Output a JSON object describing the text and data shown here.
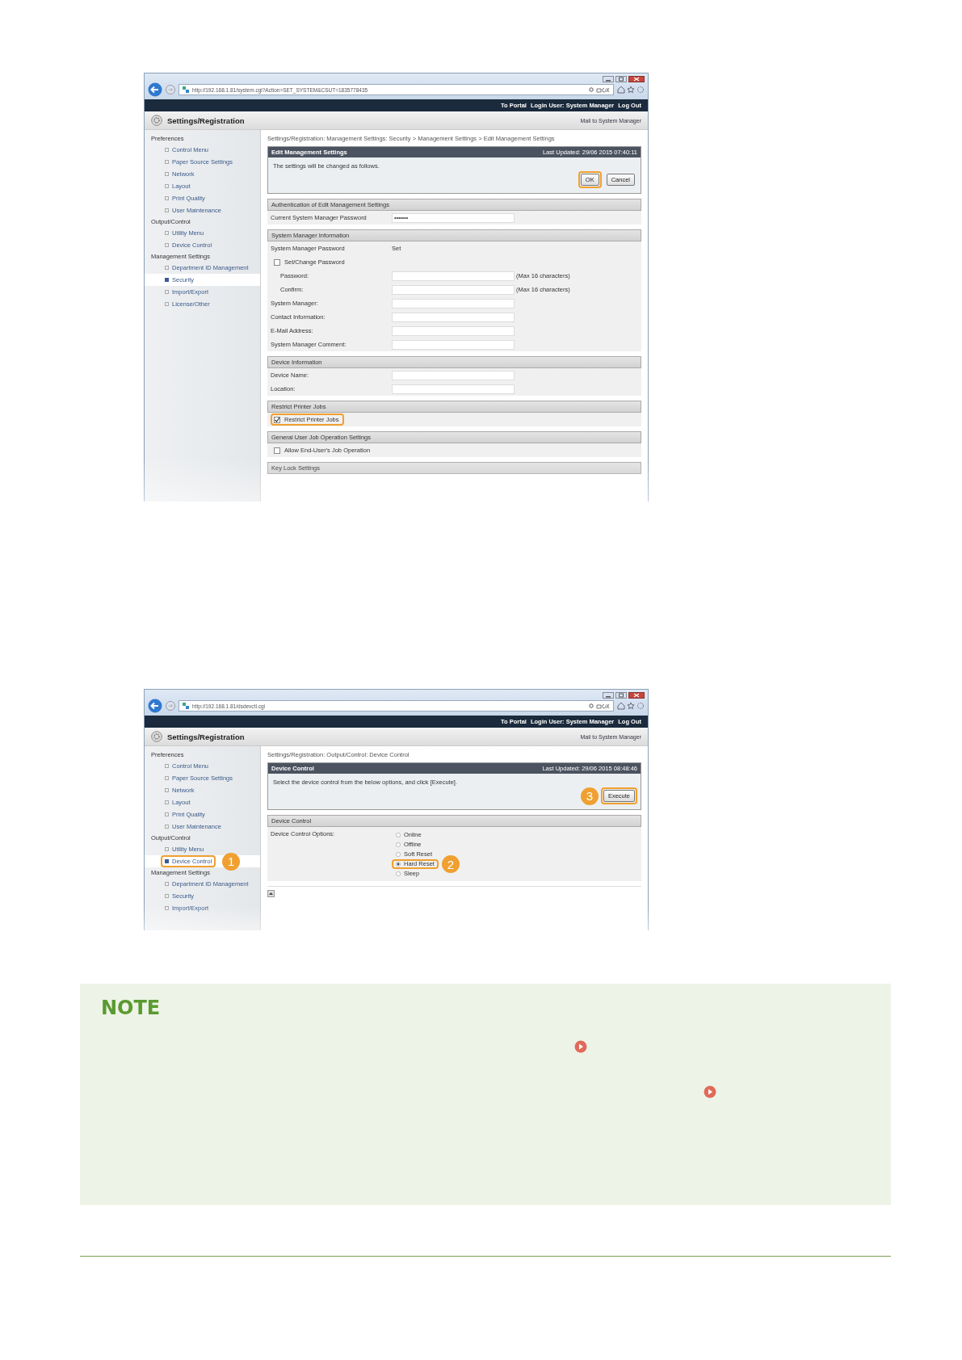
{
  "screenshots": [
    {
      "address": "http://192.168.1.81/system.cgi?Action=SET_SYSTEM&CSUT=1835778435",
      "header_links": [
        "To Portal",
        "Login User: System Manager",
        "Log Out"
      ],
      "app_title": "Settings/Registration",
      "mail_link": "Mail to System Manager",
      "sidebar": [
        {
          "heading": "Preferences",
          "items": [
            {
              "label": "Control Menu",
              "selected": false,
              "highlighted": false
            },
            {
              "label": "Paper Source Settings",
              "selected": false,
              "highlighted": false
            },
            {
              "label": "Network",
              "selected": false,
              "highlighted": false
            },
            {
              "label": "Layout",
              "selected": false,
              "highlighted": false
            },
            {
              "label": "Print Quality",
              "selected": false,
              "highlighted": false
            },
            {
              "label": "User Maintenance",
              "selected": false,
              "highlighted": false
            }
          ]
        },
        {
          "heading": "Output/Control",
          "items": [
            {
              "label": "Utility Menu",
              "selected": false,
              "highlighted": false
            },
            {
              "label": "Device Control",
              "selected": false,
              "highlighted": false
            }
          ]
        },
        {
          "heading": "Management Settings",
          "items": [
            {
              "label": "Department ID Management",
              "selected": false,
              "highlighted": false
            },
            {
              "label": "Security",
              "selected": true,
              "highlighted": false
            },
            {
              "label": "Import/Export",
              "selected": false,
              "highlighted": false
            },
            {
              "label": "License/Other",
              "selected": false,
              "highlighted": false
            }
          ]
        }
      ],
      "breadcrumb": "Settings/Registration: Management Settings: Security > Management Settings > Edit Management Settings",
      "panel": {
        "title": "Edit Management Settings",
        "last_updated": "Last Updated: 29/06 2015 07:40:11",
        "message": "The settings will be changed as follows.",
        "buttons": [
          {
            "label": "OK",
            "highlighted": true
          },
          {
            "label": "Cancel",
            "highlighted": false
          }
        ]
      },
      "sections": [
        {
          "title": "Authentication of Edit Management Settings",
          "rows": [
            {
              "kind": "field",
              "label": "Current System Manager Password",
              "value": "•••••••"
            }
          ]
        },
        {
          "title": "System Manager Information",
          "rows": [
            {
              "kind": "value",
              "label": "System Manager Password",
              "value": "Set"
            },
            {
              "kind": "check",
              "label": "Set/Change Password",
              "checked": false,
              "highlighted": false
            },
            {
              "kind": "field",
              "label": "Password:",
              "note": "(Max 16 characters)",
              "indent": true
            },
            {
              "kind": "field",
              "label": "Confirm:",
              "note": "(Max 16 characters)",
              "indent": true
            },
            {
              "kind": "field",
              "label": "System Manager:"
            },
            {
              "kind": "field",
              "label": "Contact Information:"
            },
            {
              "kind": "field",
              "label": "E-Mail Address:"
            },
            {
              "kind": "field",
              "label": "System Manager Comment:"
            }
          ]
        },
        {
          "title": "Device Information",
          "rows": [
            {
              "kind": "field",
              "label": "Device Name:"
            },
            {
              "kind": "field",
              "label": "Location:"
            }
          ]
        },
        {
          "title": "Restrict Printer Jobs",
          "rows": [
            {
              "kind": "check",
              "label": "Restrict Printer Jobs",
              "checked": true,
              "highlighted": true
            }
          ]
        },
        {
          "title": "General User Job Operation Settings",
          "rows": [
            {
              "kind": "check",
              "label": "Allow End-User's Job Operation",
              "checked": false,
              "highlighted": false
            }
          ]
        },
        {
          "title": "Key Lock Settings"
        }
      ]
    },
    {
      "address": "http://192.168.1.81/dsdevctl.cgi",
      "header_links": [
        "To Portal",
        "Login User: System Manager",
        "Log Out"
      ],
      "app_title": "Settings/Registration",
      "mail_link": "Mail to System Manager",
      "sidebar": [
        {
          "heading": "Preferences",
          "items": [
            {
              "label": "Control Menu",
              "selected": false,
              "highlighted": false
            },
            {
              "label": "Paper Source Settings",
              "selected": false,
              "highlighted": false
            },
            {
              "label": "Network",
              "selected": false,
              "highlighted": false
            },
            {
              "label": "Layout",
              "selected": false,
              "highlighted": false
            },
            {
              "label": "Print Quality",
              "selected": false,
              "highlighted": false
            },
            {
              "label": "User Maintenance",
              "selected": false,
              "highlighted": false
            }
          ]
        },
        {
          "heading": "Output/Control",
          "items": [
            {
              "label": "Utility Menu",
              "selected": false,
              "highlighted": false
            },
            {
              "label": "Device Control",
              "selected": true,
              "highlighted": true,
              "callout": "1"
            }
          ]
        },
        {
          "heading": "Management Settings",
          "items": [
            {
              "label": "Department ID Management",
              "selected": false,
              "highlighted": false
            },
            {
              "label": "Security",
              "selected": false,
              "highlighted": false
            },
            {
              "label": "Import/Export",
              "selected": false,
              "highlighted": false
            }
          ]
        }
      ],
      "breadcrumb": "Settings/Registration: Output/Control: Device Control",
      "panel": {
        "title": "Device Control",
        "last_updated": "Last Updated: 29/06 2015 08:48:46",
        "message": "Select the device control from the below options, and click [Execute].",
        "buttons": [
          {
            "label": "Execute",
            "highlighted": true,
            "callout": "3"
          }
        ]
      },
      "sections": [
        {
          "title": "Device Control",
          "rows": [
            {
              "kind": "radios",
              "label": "Device Control Options:",
              "options": [
                {
                  "label": "Online",
                  "selected": false,
                  "highlighted": false
                },
                {
                  "label": "Offline",
                  "selected": false,
                  "highlighted": false
                },
                {
                  "label": "Soft Reset",
                  "selected": false,
                  "highlighted": false
                },
                {
                  "label": "Hard Reset",
                  "selected": true,
                  "highlighted": true,
                  "callout": "2"
                },
                {
                  "label": "Sleep",
                  "selected": false,
                  "highlighted": false
                }
              ]
            }
          ]
        }
      ],
      "page_top": true
    }
  ],
  "note": {
    "title": "NOTE"
  }
}
